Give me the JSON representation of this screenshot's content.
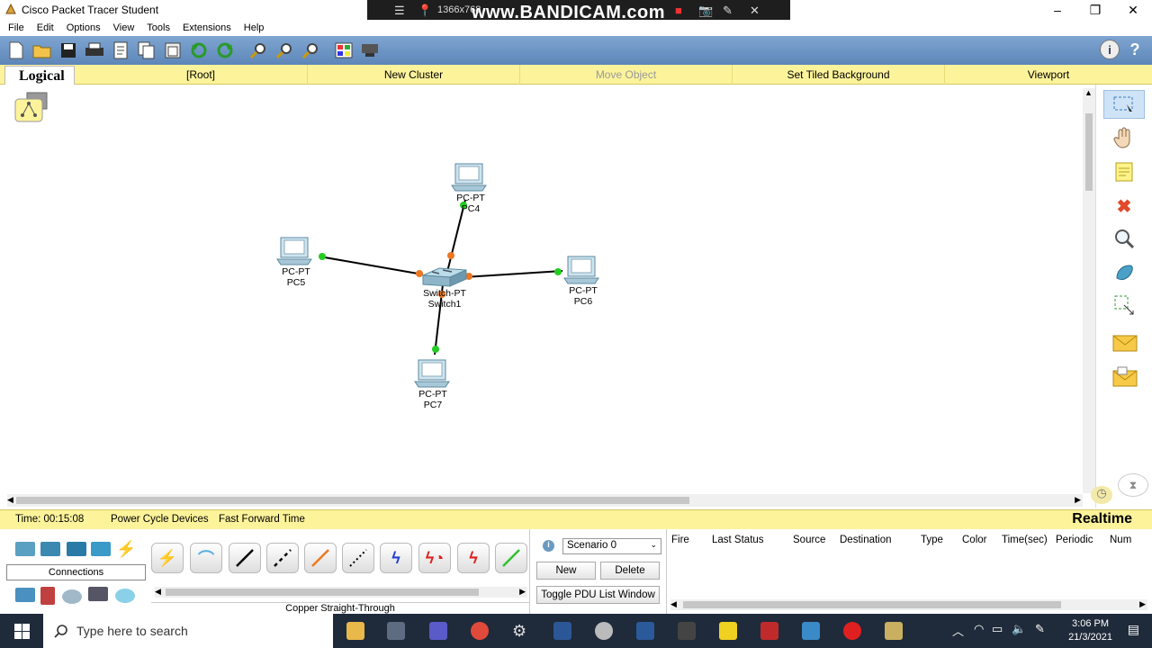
{
  "window": {
    "title": "Cisco Packet Tracer Student",
    "controls": [
      "–",
      "❐",
      "✕"
    ]
  },
  "bandicam": {
    "resolution": "1366x768",
    "watermark": "www.BANDICAM.com"
  },
  "menu": [
    "File",
    "Edit",
    "Options",
    "View",
    "Tools",
    "Extensions",
    "Help"
  ],
  "toolbar": {
    "icons": [
      "new-icon",
      "open-icon",
      "save-icon",
      "print-icon",
      "activity-wizard-icon",
      "copy-icon",
      "paste-icon",
      "undo-icon",
      "redo-icon",
      "zoom-in-icon",
      "zoom-reset-icon",
      "zoom-out-icon",
      "palette-icon",
      "device-template-icon"
    ],
    "info_label": "i",
    "help_label": "?"
  },
  "logical_bar": {
    "tab": "Logical",
    "items": [
      "[Root]",
      "New Cluster",
      "Move Object",
      "Set Tiled Background",
      "Viewport"
    ]
  },
  "network": {
    "devices": [
      {
        "type": "PC-PT",
        "name": "PC4"
      },
      {
        "type": "PC-PT",
        "name": "PC5"
      },
      {
        "type": "Switch-PT",
        "name": "Switch1"
      },
      {
        "type": "PC-PT",
        "name": "PC6"
      },
      {
        "type": "PC-PT",
        "name": "PC7"
      }
    ],
    "link_colors": {
      "up": "#22cc22",
      "pending": "#ee7722"
    }
  },
  "right_palette": [
    "select-icon",
    "hand-icon",
    "note-icon",
    "delete-icon",
    "inspect-icon",
    "draw-shape-icon",
    "resize-icon",
    "add-simple-pdu-icon",
    "add-complex-pdu-icon"
  ],
  "status": {
    "time": "Time: 00:15:08",
    "power_cycle": "Power Cycle Devices",
    "fast_forward": "Fast Forward Time",
    "mode": "Realtime"
  },
  "devices_panel": {
    "category_label": "Connections"
  },
  "cables": {
    "selected_name": "Copper Straight-Through",
    "icons": [
      "auto-connect-icon",
      "console-cable-icon",
      "straight-through-icon",
      "crossover-icon",
      "fiber-icon",
      "phone-cable-icon",
      "coax-icon",
      "serial-dce-icon",
      "serial-dte-icon",
      "octal-icon"
    ]
  },
  "scenario": {
    "selected": "Scenario 0",
    "new_label": "New",
    "delete_label": "Delete",
    "toggle_label": "Toggle PDU List Window"
  },
  "pdu_columns": [
    "Fire",
    "Last Status",
    "Source",
    "Destination",
    "Type",
    "Color",
    "Time(sec)",
    "Periodic",
    "Num"
  ],
  "taskbar": {
    "search_placeholder": "Type here to search",
    "time": "3:06 PM",
    "date": "21/3/2021"
  }
}
